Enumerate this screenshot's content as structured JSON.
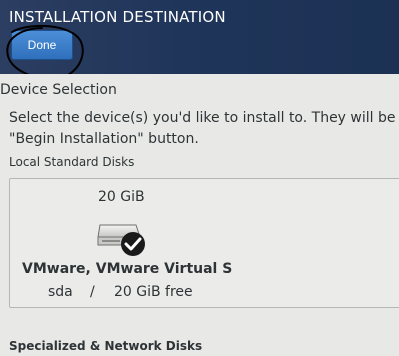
{
  "header": {
    "title": "INSTALLATION DESTINATION",
    "done_label": "Done",
    "background_color": "#1f3559"
  },
  "device_selection": {
    "title": "Device Selection",
    "description_line1": "Select the device(s) you'd like to install to.  They will be",
    "description_line2": "\"Begin Installation\" button."
  },
  "local_disks": {
    "title": "Local Standard Disks",
    "disks": [
      {
        "size": "20 GiB",
        "icon": "hard-disk-icon",
        "selected_icon": "checkmark-icon",
        "name": "VMware, VMware Virtual S",
        "device": "sda",
        "separator": "/",
        "free": "20 GiB free"
      }
    ]
  },
  "network_disks": {
    "title": "Specialized & Network Disks"
  }
}
